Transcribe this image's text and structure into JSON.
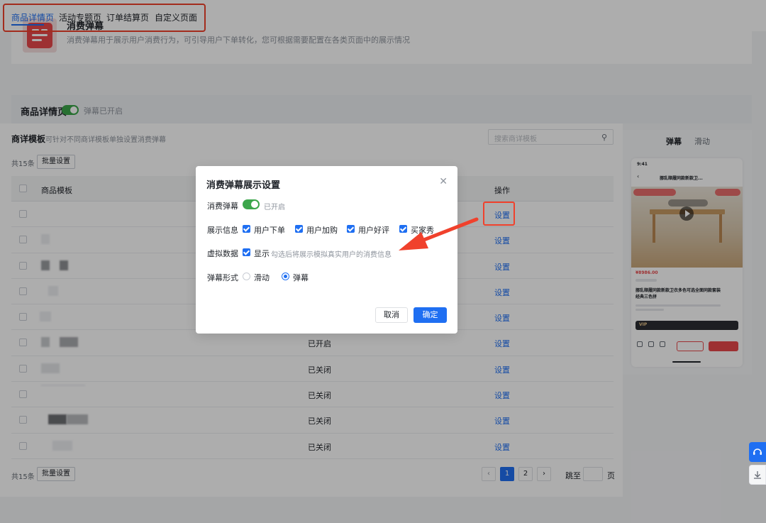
{
  "header": {
    "title": "消费弹幕",
    "description": "消费弹幕用于展示用户消费行为，可引导用户下单转化，您可根据需要配置在各类页面中的展示情况"
  },
  "tabs": [
    {
      "label": "商品详情页",
      "active": true
    },
    {
      "label": "活动专题页",
      "active": false
    },
    {
      "label": "订单结算页",
      "active": false
    },
    {
      "label": "自定义页面",
      "active": false
    }
  ],
  "page_bar": {
    "title": "商品详情页",
    "status": "弹幕已开启"
  },
  "main": {
    "title": "商详模板",
    "description": "可针对不同商详模板单独设置消费弹幕",
    "search_placeholder": "搜索商详模板",
    "total": "共15条",
    "batch_label": "批量设置"
  },
  "table": {
    "headers": {
      "name": "商品模板",
      "action": "操作"
    },
    "rows": [
      {
        "status": "",
        "action": "设置"
      },
      {
        "status": "",
        "action": "设置"
      },
      {
        "status": "",
        "action": "设置"
      },
      {
        "status": "",
        "action": "设置"
      },
      {
        "status": "",
        "action": "设置"
      },
      {
        "status": "已开启",
        "action": "设置"
      },
      {
        "status": "已关闭",
        "action": "设置"
      },
      {
        "status": "已关闭",
        "action": "设置"
      },
      {
        "status": "已关闭",
        "action": "设置"
      },
      {
        "status": "已关闭",
        "action": "设置"
      }
    ]
  },
  "pagination": {
    "pages": [
      "1",
      "2"
    ],
    "current": "1",
    "goto_label": "跳至",
    "page_suffix": "页",
    "prev_icon": "chevron-left-icon",
    "next_icon": "chevron-right-icon"
  },
  "preview": {
    "tabs": [
      "弹幕",
      "滑动"
    ],
    "status_time": "9:41",
    "nav_title": "挪乱顺履同款新款卫...",
    "price": "¥8986.00",
    "product_name": "挪乱顺履同款新款卫衣多色可选全面同款套装经典三色拼",
    "vip_text": "VIP"
  },
  "modal": {
    "title": "消费弹幕展示设置",
    "close_icon": "close-icon",
    "fields": {
      "danmu_label": "消费弹幕",
      "danmu_status": "已开启",
      "info_label": "展示信息",
      "info_options": [
        "用户下单",
        "用户加购",
        "用户好评",
        "买家秀"
      ],
      "virtual_label": "虚拟数据",
      "virtual_option": "显示",
      "virtual_hint": "勾选后将展示模拟真实用户的消费信息",
      "style_label": "弹幕形式",
      "style_options": [
        "滑动",
        "弹幕"
      ],
      "style_selected": "弹幕"
    },
    "cancel_label": "取消",
    "ok_label": "确定"
  },
  "colors": {
    "primary": "#1f6ff2",
    "switch_on": "#3ca64b",
    "annotation": "#f0412c",
    "brand_red": "#e8474a"
  }
}
